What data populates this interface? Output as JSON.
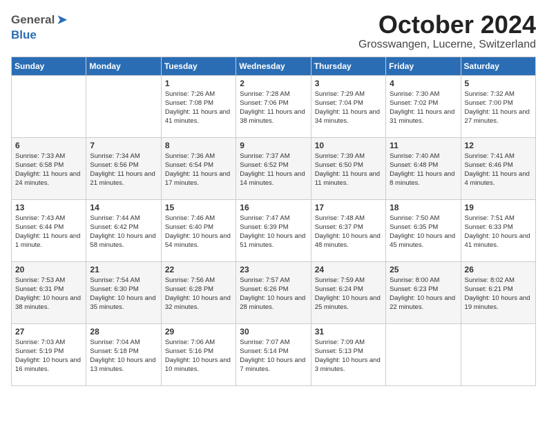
{
  "header": {
    "logo_general": "General",
    "logo_blue": "Blue",
    "month_title": "October 2024",
    "location": "Grosswangen, Lucerne, Switzerland"
  },
  "weekdays": [
    "Sunday",
    "Monday",
    "Tuesday",
    "Wednesday",
    "Thursday",
    "Friday",
    "Saturday"
  ],
  "weeks": [
    [
      {
        "day": "",
        "info": ""
      },
      {
        "day": "",
        "info": ""
      },
      {
        "day": "1",
        "info": "Sunrise: 7:26 AM\nSunset: 7:08 PM\nDaylight: 11 hours and 41 minutes."
      },
      {
        "day": "2",
        "info": "Sunrise: 7:28 AM\nSunset: 7:06 PM\nDaylight: 11 hours and 38 minutes."
      },
      {
        "day": "3",
        "info": "Sunrise: 7:29 AM\nSunset: 7:04 PM\nDaylight: 11 hours and 34 minutes."
      },
      {
        "day": "4",
        "info": "Sunrise: 7:30 AM\nSunset: 7:02 PM\nDaylight: 11 hours and 31 minutes."
      },
      {
        "day": "5",
        "info": "Sunrise: 7:32 AM\nSunset: 7:00 PM\nDaylight: 11 hours and 27 minutes."
      }
    ],
    [
      {
        "day": "6",
        "info": "Sunrise: 7:33 AM\nSunset: 6:58 PM\nDaylight: 11 hours and 24 minutes."
      },
      {
        "day": "7",
        "info": "Sunrise: 7:34 AM\nSunset: 6:56 PM\nDaylight: 11 hours and 21 minutes."
      },
      {
        "day": "8",
        "info": "Sunrise: 7:36 AM\nSunset: 6:54 PM\nDaylight: 11 hours and 17 minutes."
      },
      {
        "day": "9",
        "info": "Sunrise: 7:37 AM\nSunset: 6:52 PM\nDaylight: 11 hours and 14 minutes."
      },
      {
        "day": "10",
        "info": "Sunrise: 7:39 AM\nSunset: 6:50 PM\nDaylight: 11 hours and 11 minutes."
      },
      {
        "day": "11",
        "info": "Sunrise: 7:40 AM\nSunset: 6:48 PM\nDaylight: 11 hours and 8 minutes."
      },
      {
        "day": "12",
        "info": "Sunrise: 7:41 AM\nSunset: 6:46 PM\nDaylight: 11 hours and 4 minutes."
      }
    ],
    [
      {
        "day": "13",
        "info": "Sunrise: 7:43 AM\nSunset: 6:44 PM\nDaylight: 11 hours and 1 minute."
      },
      {
        "day": "14",
        "info": "Sunrise: 7:44 AM\nSunset: 6:42 PM\nDaylight: 10 hours and 58 minutes."
      },
      {
        "day": "15",
        "info": "Sunrise: 7:46 AM\nSunset: 6:40 PM\nDaylight: 10 hours and 54 minutes."
      },
      {
        "day": "16",
        "info": "Sunrise: 7:47 AM\nSunset: 6:39 PM\nDaylight: 10 hours and 51 minutes."
      },
      {
        "day": "17",
        "info": "Sunrise: 7:48 AM\nSunset: 6:37 PM\nDaylight: 10 hours and 48 minutes."
      },
      {
        "day": "18",
        "info": "Sunrise: 7:50 AM\nSunset: 6:35 PM\nDaylight: 10 hours and 45 minutes."
      },
      {
        "day": "19",
        "info": "Sunrise: 7:51 AM\nSunset: 6:33 PM\nDaylight: 10 hours and 41 minutes."
      }
    ],
    [
      {
        "day": "20",
        "info": "Sunrise: 7:53 AM\nSunset: 6:31 PM\nDaylight: 10 hours and 38 minutes."
      },
      {
        "day": "21",
        "info": "Sunrise: 7:54 AM\nSunset: 6:30 PM\nDaylight: 10 hours and 35 minutes."
      },
      {
        "day": "22",
        "info": "Sunrise: 7:56 AM\nSunset: 6:28 PM\nDaylight: 10 hours and 32 minutes."
      },
      {
        "day": "23",
        "info": "Sunrise: 7:57 AM\nSunset: 6:26 PM\nDaylight: 10 hours and 28 minutes."
      },
      {
        "day": "24",
        "info": "Sunrise: 7:59 AM\nSunset: 6:24 PM\nDaylight: 10 hours and 25 minutes."
      },
      {
        "day": "25",
        "info": "Sunrise: 8:00 AM\nSunset: 6:23 PM\nDaylight: 10 hours and 22 minutes."
      },
      {
        "day": "26",
        "info": "Sunrise: 8:02 AM\nSunset: 6:21 PM\nDaylight: 10 hours and 19 minutes."
      }
    ],
    [
      {
        "day": "27",
        "info": "Sunrise: 7:03 AM\nSunset: 5:19 PM\nDaylight: 10 hours and 16 minutes."
      },
      {
        "day": "28",
        "info": "Sunrise: 7:04 AM\nSunset: 5:18 PM\nDaylight: 10 hours and 13 minutes."
      },
      {
        "day": "29",
        "info": "Sunrise: 7:06 AM\nSunset: 5:16 PM\nDaylight: 10 hours and 10 minutes."
      },
      {
        "day": "30",
        "info": "Sunrise: 7:07 AM\nSunset: 5:14 PM\nDaylight: 10 hours and 7 minutes."
      },
      {
        "day": "31",
        "info": "Sunrise: 7:09 AM\nSunset: 5:13 PM\nDaylight: 10 hours and 3 minutes."
      },
      {
        "day": "",
        "info": ""
      },
      {
        "day": "",
        "info": ""
      }
    ]
  ]
}
